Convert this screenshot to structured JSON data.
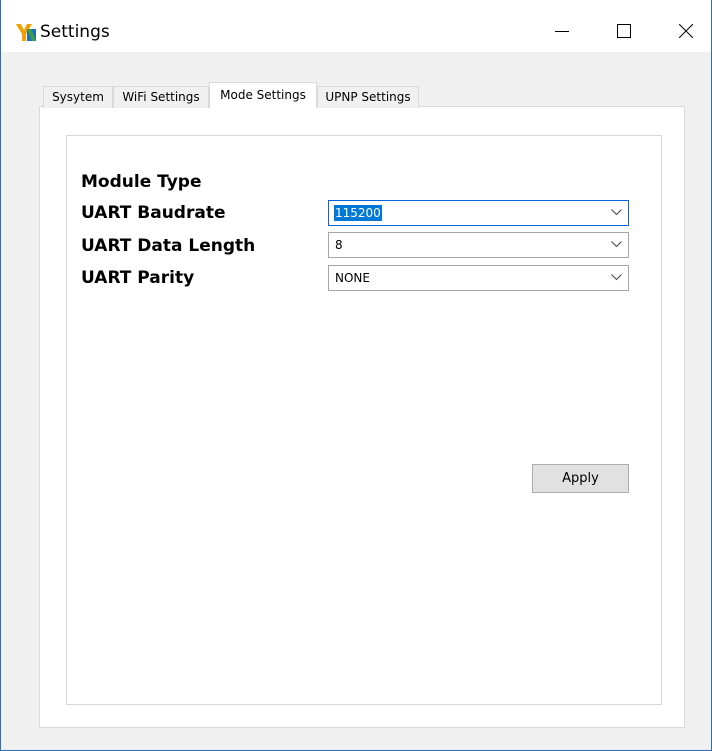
{
  "window": {
    "title": "Settings",
    "icon": "app-logo-icon",
    "controls": [
      "minimize-icon",
      "maximize-icon",
      "close-icon"
    ]
  },
  "tabs": [
    {
      "label": "Sysytem",
      "active": false
    },
    {
      "label": "WiFi Settings",
      "active": false
    },
    {
      "label": "Mode Settings",
      "active": true
    },
    {
      "label": "UPNP Settings",
      "active": false
    }
  ],
  "mode_settings": {
    "module_type_label": "Module Type",
    "baudrate_label": "UART Baudrate",
    "baudrate_value": "115200",
    "data_length_label": "UART Data Length",
    "data_length_value": "8",
    "parity_label": "UART Parity",
    "parity_value": "NONE",
    "apply_label": "Apply"
  },
  "colors": {
    "accent": "#0078d7",
    "window_border": "#2b6fb6"
  }
}
